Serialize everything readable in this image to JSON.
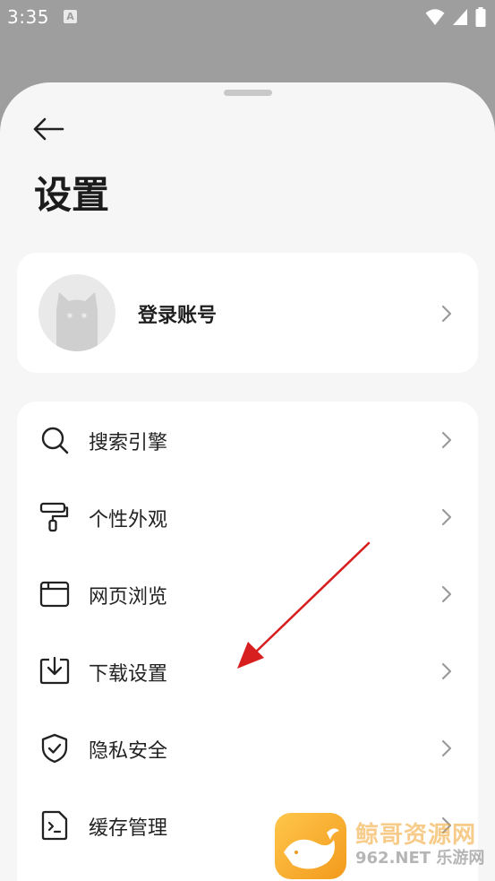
{
  "status_bar": {
    "time": "3:35",
    "notification_badge": "A"
  },
  "header": {
    "title": "设置"
  },
  "account": {
    "label": "登录账号"
  },
  "settings": {
    "items": [
      {
        "label": "搜索引擎",
        "icon": "search-icon"
      },
      {
        "label": "个性外观",
        "icon": "paint-roller-icon"
      },
      {
        "label": "网页浏览",
        "icon": "browser-window-icon"
      },
      {
        "label": "下载设置",
        "icon": "download-icon"
      },
      {
        "label": "隐私安全",
        "icon": "shield-check-icon"
      },
      {
        "label": "缓存管理",
        "icon": "terminal-file-icon"
      }
    ]
  },
  "watermark": {
    "text": "鲸哥资源网",
    "sub": "962.NET 乐游网"
  },
  "colors": {
    "backdrop": "#9e9e9e",
    "sheet": "#f6f6f6",
    "card": "#ffffff",
    "annotation": "#d81f1f"
  }
}
